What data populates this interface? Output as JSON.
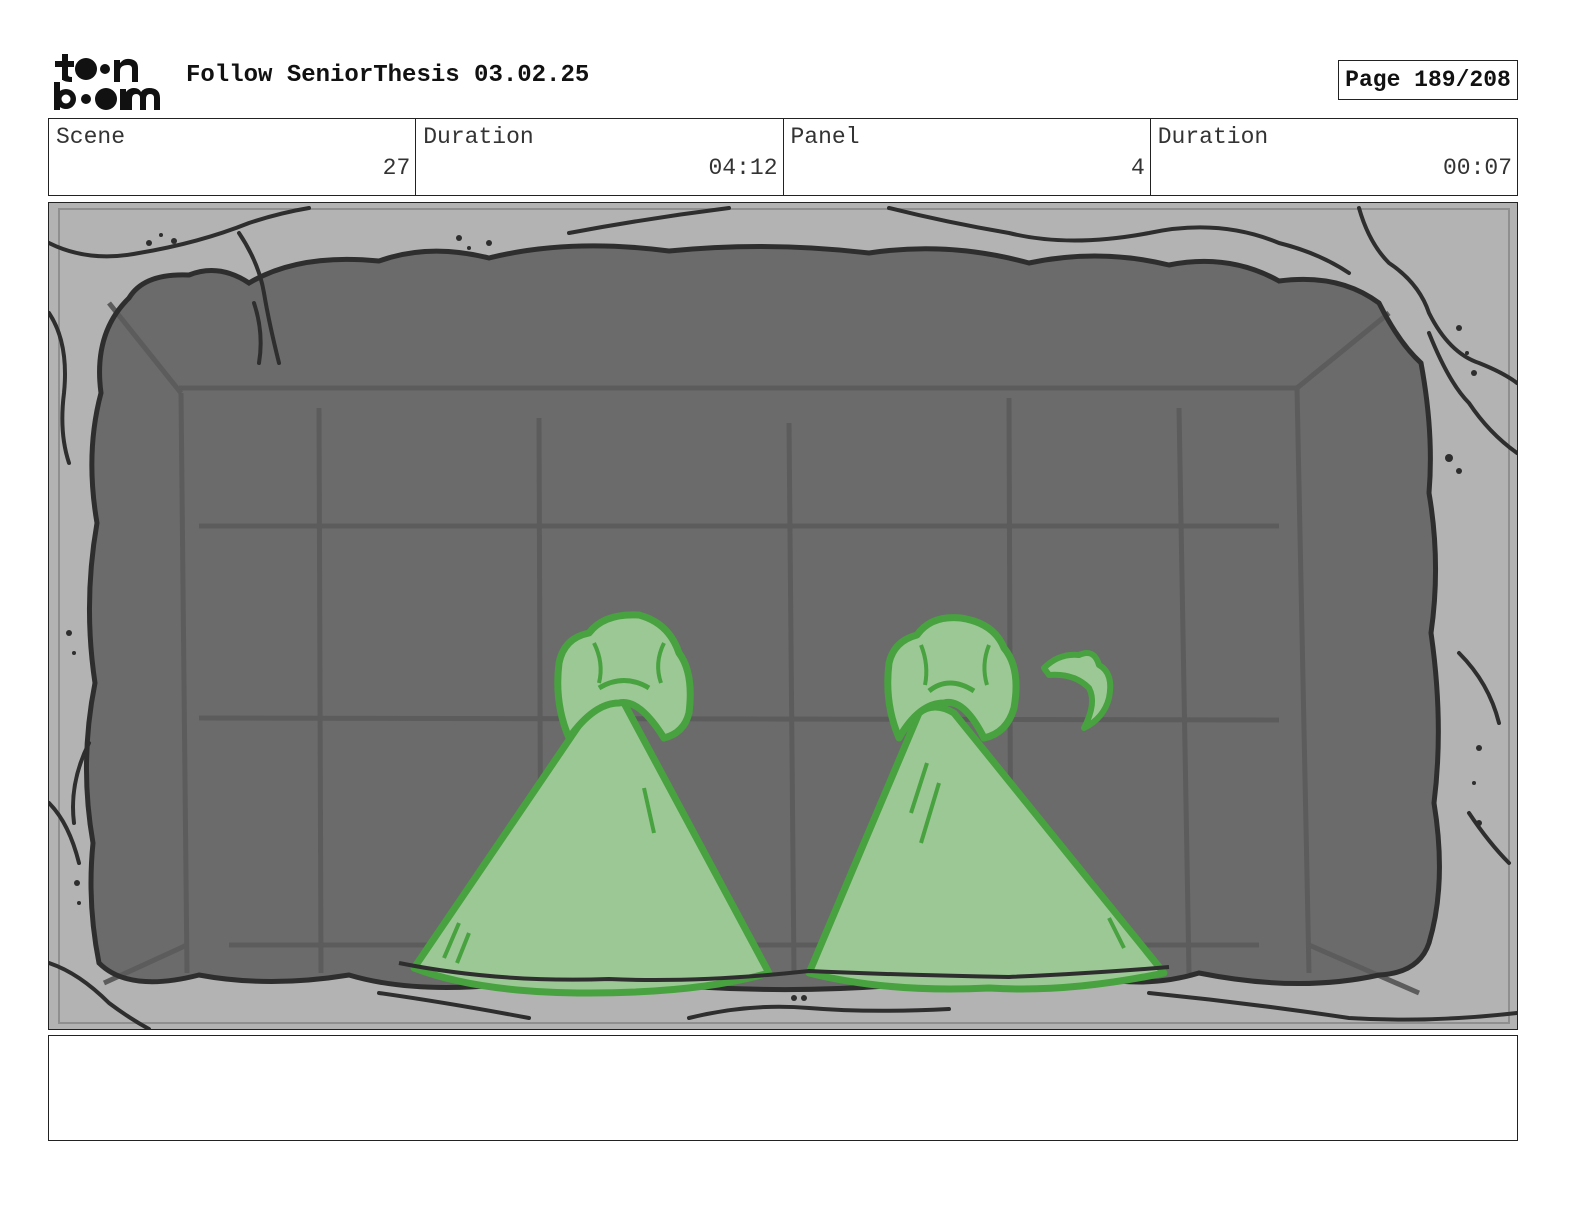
{
  "header": {
    "logo_text": "toon boom",
    "title": "Follow SeniorThesis 03.02.25",
    "page_label": "Page 189/208"
  },
  "info": [
    {
      "label": "Scene",
      "value": "27"
    },
    {
      "label": "Duration",
      "value": "04:12"
    },
    {
      "label": "Panel",
      "value": "4"
    },
    {
      "label": "Duration",
      "value": "00:07"
    }
  ],
  "panel": {
    "image_description": "",
    "colors": {
      "frame_stone": "#b3b3b3",
      "wall": "#6b6b6b",
      "grid_line": "#5c5c5c",
      "outline": "#2e2e2e",
      "figure_fill": "#9cc895",
      "figure_line": "#48a23f"
    }
  },
  "notes": {
    "text": ""
  }
}
